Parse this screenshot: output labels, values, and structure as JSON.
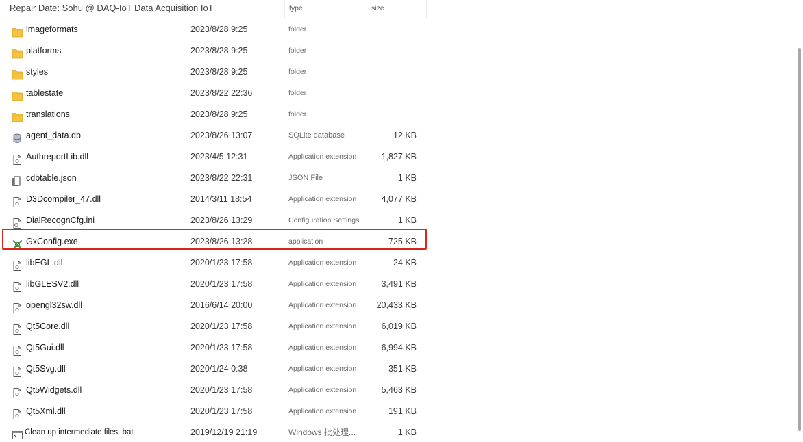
{
  "header": {
    "title": "Repair Date: Sohu @ DAQ-IoT Data Acquisition IoT",
    "col_type": "type",
    "col_size": "size"
  },
  "files": [
    {
      "name": "imageformats",
      "date": "2023/8/28 9:25",
      "type": "folder",
      "size": "",
      "icon": "folder-icon"
    },
    {
      "name": "platforms",
      "date": "2023/8/28 9:25",
      "type": "folder",
      "size": "",
      "icon": "folder-icon"
    },
    {
      "name": "styles",
      "date": "2023/8/28 9:25",
      "type": "folder",
      "size": "",
      "icon": "folder-icon"
    },
    {
      "name": "tablestate",
      "date": "2023/8/22 22:36",
      "type": "folder",
      "size": "",
      "icon": "folder-icon"
    },
    {
      "name": "translations",
      "date": "2023/8/28 9:25",
      "type": "folder",
      "size": "",
      "icon": "folder-icon"
    },
    {
      "name": "agent_data.db",
      "date": "2023/8/26 13:07",
      "type": "SQLite database",
      "size": "12 KB",
      "icon": "database-file-icon"
    },
    {
      "name": "AuthreportLib.dll",
      "date": "2023/4/5 12:31",
      "type": "Application extension",
      "size": "1,827 KB",
      "icon": "dll-file-icon"
    },
    {
      "name": "cdbtable.json",
      "date": "2023/8/22 22:31",
      "type": "JSON File",
      "size": "1 KB",
      "icon": "json-file-icon"
    },
    {
      "name": "D3Dcompiler_47.dll",
      "date": "2014/3/11 18:54",
      "type": "Application extension",
      "size": "4,077 KB",
      "icon": "dll-file-icon"
    },
    {
      "name": "DialRecognCfg.ini",
      "date": "2023/8/26 13:29",
      "type": "Configuration Settings",
      "size": "1 KB",
      "icon": "settings-file-icon"
    },
    {
      "name": "GxConfig.exe",
      "date": "2023/8/26 13:28",
      "type": "application",
      "size": "725 KB",
      "icon": "app-exe-icon"
    },
    {
      "name": "libEGL.dll",
      "date": "2020/1/23 17:58",
      "type": "Application extension",
      "size": "24 KB",
      "icon": "dll-file-icon"
    },
    {
      "name": "libGLESV2.dll",
      "date": "2020/1/23 17:58",
      "type": "Application extension",
      "size": "3,491 KB",
      "icon": "dll-file-icon"
    },
    {
      "name": "opengl32sw.dll",
      "date": "2016/6/14 20:00",
      "type": "Application extension",
      "size": "20,433 KB",
      "icon": "dll-file-icon"
    },
    {
      "name": "Qt5Core.dll",
      "date": "2020/1/23 17:58",
      "type": "Application extension",
      "size": "6,019 KB",
      "icon": "dll-file-icon"
    },
    {
      "name": "Qt5Gui.dll",
      "date": "2020/1/23 17:58",
      "type": "Application extension",
      "size": "6,994 KB",
      "icon": "dll-file-icon"
    },
    {
      "name": "Qt5Svg.dll",
      "date": "2020/1/24 0:38",
      "type": "Application extension",
      "size": "351 KB",
      "icon": "dll-file-icon"
    },
    {
      "name": "Qt5Widgets.dll",
      "date": "2020/1/23 17:58",
      "type": "Application extension",
      "size": "5,463 KB",
      "icon": "dll-file-icon"
    },
    {
      "name": "Qt5Xml.dll",
      "date": "2020/1/23 17:58",
      "type": "Application extension",
      "size": "191 KB",
      "icon": "dll-file-icon"
    },
    {
      "name": "Clean up intermediate files. bat",
      "date": "2019/12/19 21:19",
      "type": "Windows 批处理...",
      "size": "1 KB",
      "icon": "batch-file-icon"
    }
  ],
  "colors": {
    "highlight_border": "#d9261c",
    "folder": "#f5c342"
  }
}
